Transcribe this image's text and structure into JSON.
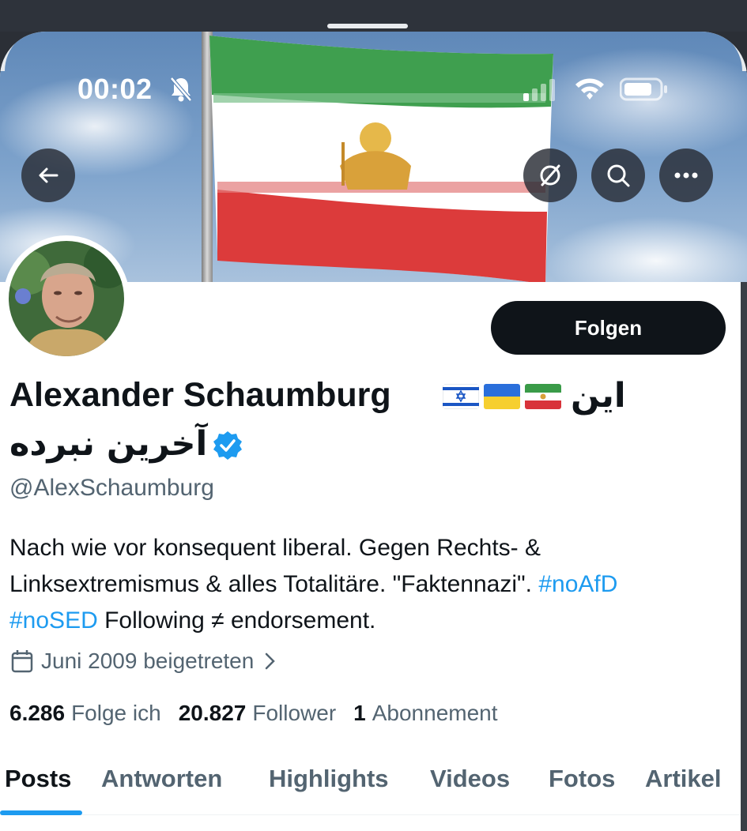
{
  "status_bar": {
    "time": "00:02"
  },
  "header": {
    "back_icon": "arrow-left-icon",
    "grok_icon": "grok-icon",
    "search_icon": "search-icon",
    "more_icon": "more-icon"
  },
  "profile": {
    "display_name": "Alexander Schaumburg",
    "display_name_rtl_1": "این",
    "display_name_rtl_2": "آخرین نبرده",
    "flags": [
      "Israel",
      "Ukraine",
      "Iran (Lion and Sun)"
    ],
    "verified": true,
    "handle": "@AlexSchaumburg",
    "follow_label": "Folgen",
    "bio": {
      "line1": "Nach wie vor konsequent liberal. Gegen Rechts- &",
      "line2": "Linksextremismus & alles Totalitäre. \"Faktennazi\".",
      "tag1": "#noAfD",
      "tag2": "#noSED",
      "line3_rest": "Following ≠ endorsement."
    },
    "joined": "Juni 2009 beigetreten",
    "stats": {
      "following_count": "6.286",
      "following_label": "Folge ich",
      "followers_count": "20.827",
      "followers_label": "Follower",
      "subscriptions_count": "1",
      "subscriptions_label": "Abonnement"
    }
  },
  "tabs": {
    "posts": "Posts",
    "replies": "Antworten",
    "highlights": "Highlights",
    "videos": "Videos",
    "photos": "Fotos",
    "articles": "Artikel",
    "active": "Posts"
  },
  "colors": {
    "accent": "#1d9bf0",
    "text_primary": "#0f1419",
    "text_secondary": "#536471",
    "button_dark": "#0f1419"
  }
}
